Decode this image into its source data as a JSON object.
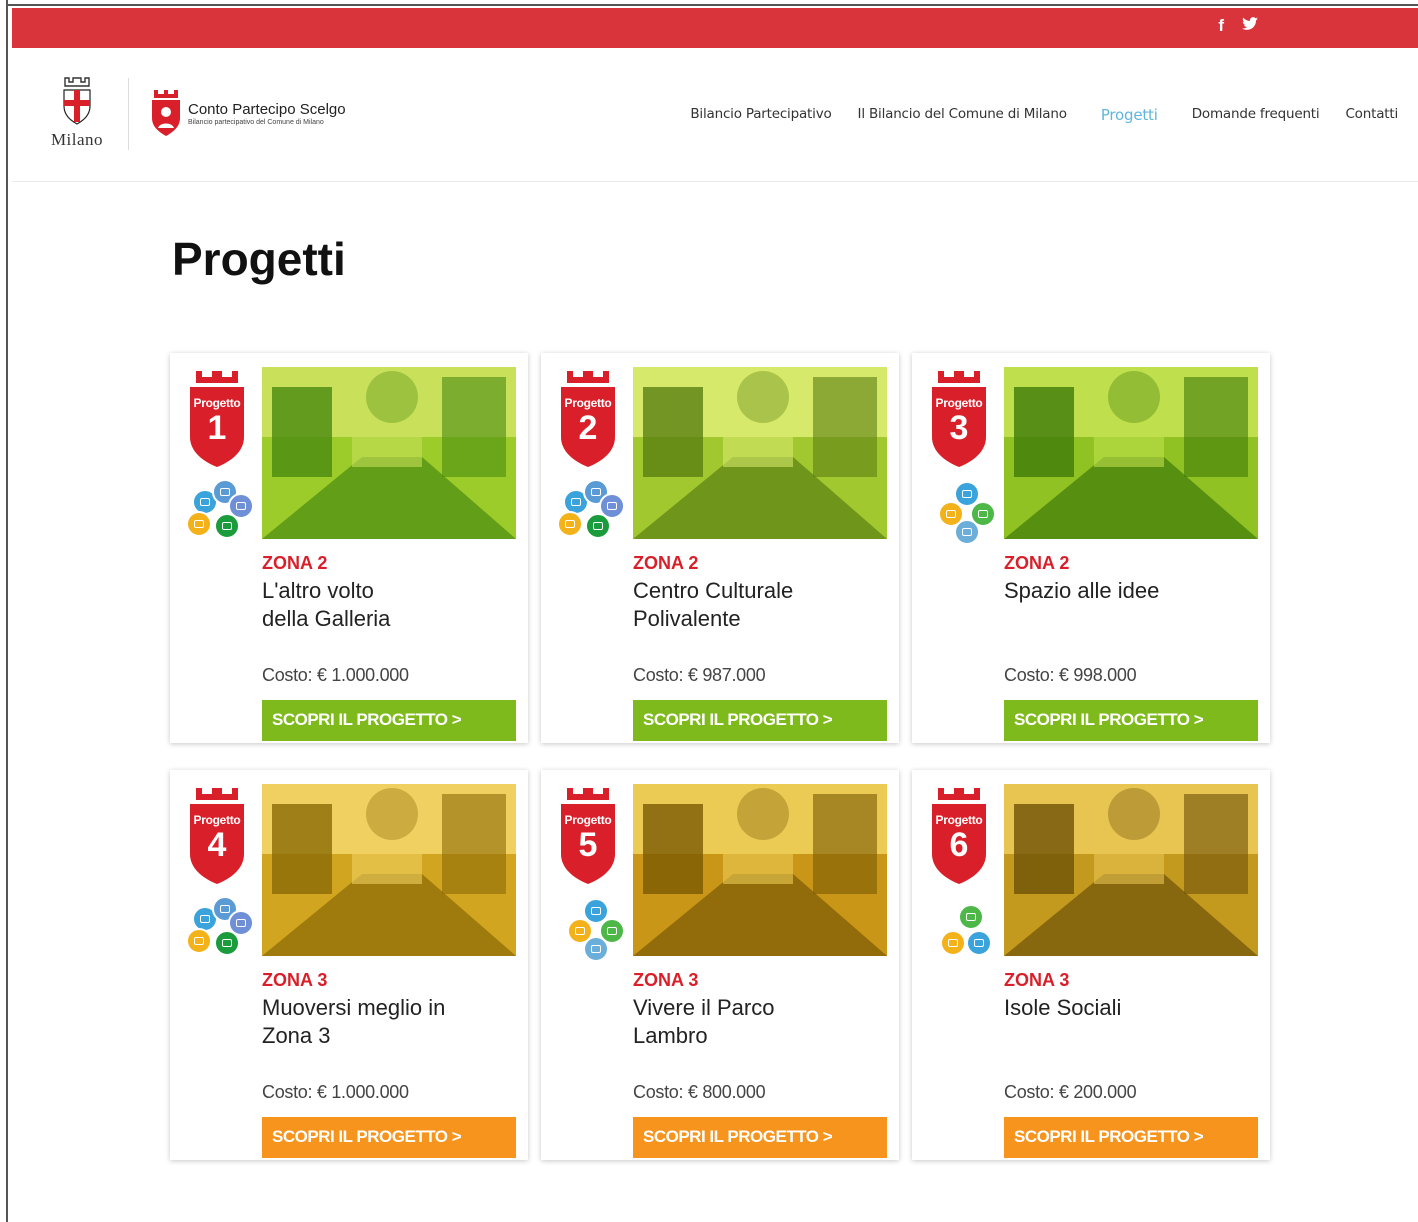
{
  "social": {
    "facebook": "f",
    "twitter": "🐦"
  },
  "logo": {
    "city": "Milano",
    "brand_title": "Conto Partecipo Scelgo",
    "brand_sub": "Bilancio partecipativo del Comune di Milano"
  },
  "nav": {
    "items": [
      {
        "label": "Bilancio Partecipativo"
      },
      {
        "label": "Il Bilancio del Comune di Milano"
      },
      {
        "label": "Progetti"
      },
      {
        "label": "Domande frequenti"
      },
      {
        "label": "Contatti"
      }
    ],
    "active": "Progetti"
  },
  "page": {
    "title": "Progetti"
  },
  "colors": {
    "topbar": "#d9343b",
    "zone": "#d9202a",
    "green_button": "#7fba1d",
    "orange_button": "#f7941d",
    "badge": "#d9202a",
    "nav_active": "#5fb6dd"
  },
  "projects": [
    {
      "badge_label": "Progetto",
      "number": "1",
      "zone": "ZONA 2",
      "title": "L'altro volto della Galleria",
      "cost": "Costo: € 1.000.000",
      "cta": "SCOPRI IL PROGETTO >",
      "icons": [
        "world-icon",
        "monitor-icon",
        "video-icon",
        "bike-icon",
        "bulb-icon"
      ]
    },
    {
      "badge_label": "Progetto",
      "number": "2",
      "zone": "ZONA 2",
      "title": "Centro Culturale Polivalente",
      "cost": "Costo: € 987.000",
      "cta": "SCOPRI IL PROGETTO >",
      "icons": [
        "world-icon",
        "monitor-icon",
        "video-icon",
        "bike-icon",
        "bulb-icon"
      ]
    },
    {
      "badge_label": "Progetto",
      "number": "3",
      "zone": "ZONA 2",
      "title": "Spazio alle idee",
      "cost": "Costo: € 998.000",
      "cta": "SCOPRI IL PROGETTO >",
      "icons": [
        "world-icon",
        "bike-icon",
        "tree-icon",
        "book-icon"
      ]
    },
    {
      "badge_label": "Progetto",
      "number": "4",
      "zone": "ZONA 3",
      "title": "Muoversi meglio in Zona 3",
      "cost": "Costo: € 1.000.000",
      "cta": "SCOPRI IL PROGETTO >",
      "icons": [
        "world-icon",
        "monitor-icon",
        "video-icon",
        "bike-icon",
        "bulb-icon"
      ]
    },
    {
      "badge_label": "Progetto",
      "number": "5",
      "zone": "ZONA 3",
      "title": "Vivere il Parco Lambro",
      "cost": "Costo: € 800.000",
      "cta": "SCOPRI IL PROGETTO >",
      "icons": [
        "world-icon",
        "bike-icon",
        "tree-icon",
        "book-icon"
      ]
    },
    {
      "badge_label": "Progetto",
      "number": "6",
      "zone": "ZONA 3",
      "title": "Isole Sociali",
      "cost": "Costo: € 200.000",
      "cta": "SCOPRI IL PROGETTO >",
      "icons": [
        "tree-icon",
        "bike-icon",
        "world-icon"
      ]
    }
  ]
}
